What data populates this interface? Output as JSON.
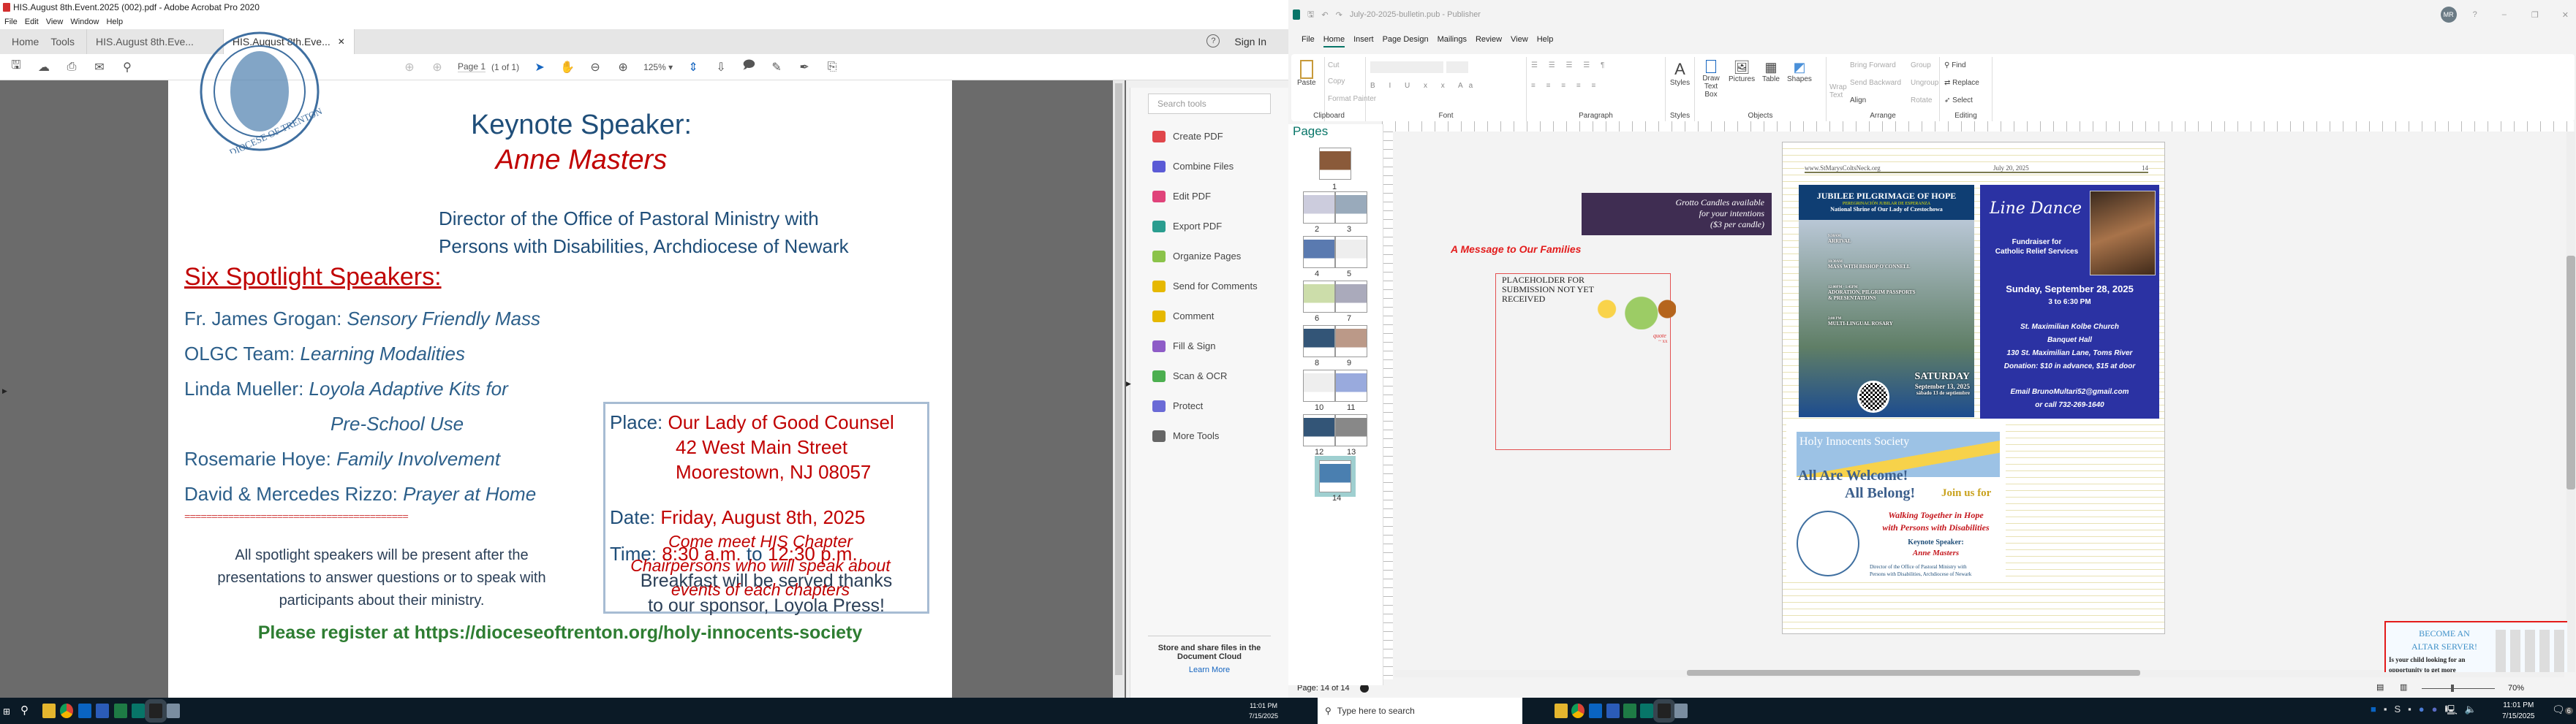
{
  "acrobat": {
    "window_title": "HIS.August 8th.Event.2025 (002).pdf - Adobe Acrobat Pro 2020",
    "menu": [
      "File",
      "Edit",
      "View",
      "Window",
      "Help"
    ],
    "tabs": [
      "Home",
      "Tools",
      "HIS.August 8th.Eve...",
      "HIS.August 8th.Eve..."
    ],
    "help_icon": "question-circle-icon",
    "sign_in": "Sign In",
    "page_label": "Page 1",
    "page_of": "(1 of 1)",
    "zoom": "125%",
    "tool_search_placeholder": "Search tools",
    "tools": [
      {
        "label": "Create PDF",
        "color": "#e0464b"
      },
      {
        "label": "Combine Files",
        "color": "#5b5bd6"
      },
      {
        "label": "Edit PDF",
        "color": "#e0437a"
      },
      {
        "label": "Export PDF",
        "color": "#2a9d8f"
      },
      {
        "label": "Organize Pages",
        "color": "#8bc34a"
      },
      {
        "label": "Send for Comments",
        "color": "#e6b800"
      },
      {
        "label": "Comment",
        "color": "#e6b800"
      },
      {
        "label": "Fill & Sign",
        "color": "#8e5cc7"
      },
      {
        "label": "Scan & OCR",
        "color": "#4caf50"
      },
      {
        "label": "Protect",
        "color": "#6a6ad6"
      },
      {
        "label": "More Tools",
        "color": "#666666"
      }
    ],
    "cloud_text": "Store and share files in the Document Cloud",
    "learn_more": "Learn More",
    "flyer": {
      "seal_text": "HOLY INNOCENTS SOCIETY · DIOCESE OF TRENTON",
      "keynote_label": "Keynote Speaker:",
      "keynote_name": "Anne Masters",
      "director1": "Director of the Office of Pastoral Ministry with",
      "director2": "Persons with Disabilities,  Archdiocese of Newark",
      "spotlight_title": "Six Spotlight Speakers:",
      "speakers": [
        {
          "name": "Fr. James Grogan: ",
          "topic": "Sensory Friendly Mass"
        },
        {
          "name": "OLGC Team:  ",
          "topic": "Learning Modalities"
        },
        {
          "name": "Linda Mueller:  ",
          "topic": "Loyola Adaptive Kits for"
        },
        {
          "name": "",
          "topic": "Pre-School Use"
        },
        {
          "name": "Rosemarie Hoye:  ",
          "topic": "Family Involvement"
        },
        {
          "name": "David & Mercedes Rizzo:  ",
          "topic": "Prayer at Home"
        }
      ],
      "divider": "=========================================",
      "place_label": "Place: ",
      "place": "Our Lady of Good Counsel",
      "address1": "42 West Main Street",
      "address2": "Moorestown, NJ 08057",
      "date_label": "Date: ",
      "date": "Friday, August 8th, 2025",
      "time_label": "Time:  ",
      "time_start": "8:30 a.m.",
      "time_to": " to ",
      "time_end": "12:30 p.m.",
      "breakfast1": "Breakfast will be served thanks",
      "breakfast2": "to our sponsor, Loyola Press!",
      "note1": "All spotlight speakers will be present after the",
      "note2": "presentations to answer questions or to speak with",
      "note3": "participants about their ministry.",
      "chapter1": "Come meet HIS Chapter",
      "chapter2": "Chairpersons who will speak  about",
      "chapter3": "events of each chapters",
      "register": "Please register at https://dioceseoftrenton.org/holy-innocents-society"
    }
  },
  "publisher": {
    "window_title": "July-20-2025-bulletin.pub - Publisher",
    "avatar": "MR",
    "menu": [
      "File",
      "Home",
      "Insert",
      "Page Design",
      "Mailings",
      "Review",
      "View",
      "Help"
    ],
    "active_menu": "Home",
    "ribbon": {
      "clipboard": {
        "paste": "Paste",
        "cut": "Cut",
        "copy": "Copy",
        "format_painter": "Format Painter",
        "label": "Clipboard"
      },
      "font_label": "Font",
      "paragraph_label": "Paragraph",
      "styles": {
        "btn": "Styles",
        "label": "Styles"
      },
      "objects": {
        "draw_text_box": "Draw Text Box",
        "pictures": "Pictures",
        "table": "Table",
        "shapes": "Shapes",
        "label": "Objects"
      },
      "arrange": {
        "wrap_text": "Wrap Text",
        "bring_forward": "Bring Forward",
        "send_backward": "Send Backward",
        "align": "Align",
        "group": "Group",
        "ungroup": "Ungroup",
        "rotate": "Rotate",
        "label": "Arrange"
      },
      "editing": {
        "find": "Find",
        "replace": "Replace",
        "select": "Select",
        "label": "Editing"
      }
    },
    "pages_title": "Pages",
    "thumb_labels": [
      "1",
      "2",
      "3",
      "4",
      "5",
      "6",
      "7",
      "8",
      "9",
      "10",
      "11",
      "12",
      "13",
      "14"
    ],
    "status_page": "Page: 14 of 14",
    "zoom": "70%",
    "canvas": {
      "message_title": "A Message to Our Families",
      "placeholder": "PLACEHOLDER  FOR SUBMISSION NOT YET RECEIVED",
      "quote": "quote",
      "quote_attr": "~ xx",
      "grotto1": "Grotto Candles available",
      "grotto2": "for your intentions",
      "grotto3": "($3 per candle)",
      "header_url": "www.StMarysColtsNeck.org",
      "header_date": "July 20, 2025",
      "header_page": "14",
      "jubilee": {
        "title": "JUBILEE PILGRIMAGE OF HOPE",
        "spanish": "PEREGRINACIÓN JUBILAR DE ESPERANZA",
        "shrine": "National Shrine of Our Lady of Czestochowa",
        "schedule": [
          {
            "time": "9:30AM",
            "event": "ARRIVAL"
          },
          {
            "time": "10:30AM",
            "event": "MASS WITH BISHOP O'CONNELL"
          },
          {
            "time": "12:00PM - 1:45PM",
            "event": "ADORATION, PILGRIM PASSPORTS & PRESENTATIONS"
          },
          {
            "time": "2:00 PM",
            "event": "MULTI-LINGUAL ROSARY"
          }
        ],
        "day": "SATURDAY",
        "date": "September 13, 2025",
        "date_es": "sábado 13 de septiembre"
      },
      "linedance": {
        "title": "Line Dance",
        "sub1": "Fundraiser for",
        "sub2": "Catholic Relief Services",
        "date": "Sunday, September 28, 2025",
        "time": "3 to 6:30 PM",
        "loc1": "St. Maximilian Kolbe Church",
        "loc2": "Banquet Hall",
        "loc3": "130 St. Maximilian Lane, Toms River",
        "donation": "Donation: $10 in advance, $15 at door",
        "email": "Email BrunoMultari52@gmail.com",
        "call": "or call 732-269-1640"
      },
      "his": {
        "banner": "Holy Innocents Society",
        "welcome1": "All Are Welcome!",
        "welcome2": "All Belong!",
        "join": "Join us for",
        "walk1": "Walking Together in Hope",
        "walk2": "with Persons with Disabilities",
        "keynote": "Keynote Speaker:",
        "name": "Anne Masters",
        "dir1": "Director of the Office of Pastoral Ministry with",
        "dir2": "Persons with Disabilities,  Archdiocese of Newark"
      },
      "altar": {
        "title1": "BECOME AN",
        "title2": "ALTAR SERVER!",
        "body1": "Is your child looking for an",
        "body2": "opportunity to get more"
      }
    }
  },
  "taskbar": {
    "search_placeholder": "Type here to search",
    "time": "11:01 PM",
    "date": "7/15/2025",
    "notifications": "6",
    "left_time": "11:01 PM",
    "left_date": "7/15/2025"
  }
}
